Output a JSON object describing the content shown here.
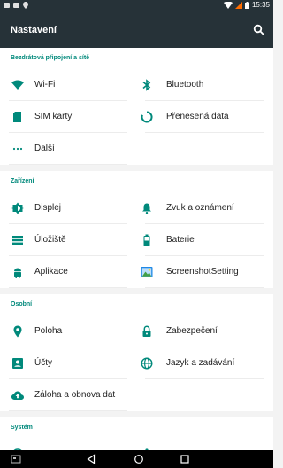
{
  "status_bar": {
    "time": "15:35",
    "left_icons": [
      "image-icon",
      "message-icon",
      "location-pin-icon"
    ],
    "right_icons": [
      "wifi-icon",
      "signal-icon",
      "battery-icon"
    ],
    "signal_accent": "#ff6d00"
  },
  "app_bar": {
    "title": "Nastavení",
    "background": "#263238"
  },
  "accent": "#00897b",
  "sections": {
    "wireless": {
      "header": "Bezdrátová připojení a sítě",
      "items": [
        {
          "label": "Wi-Fi",
          "icon": "wifi-icon"
        },
        {
          "label": "Bluetooth",
          "icon": "bluetooth-icon"
        },
        {
          "label": "SIM karty",
          "icon": "sim-card-icon"
        },
        {
          "label": "Přenesená data",
          "icon": "data-usage-icon"
        },
        {
          "label": "Další",
          "icon": "more-icon"
        }
      ]
    },
    "device": {
      "header": "Zařízení",
      "items": [
        {
          "label": "Displej",
          "icon": "display-brightness-icon"
        },
        {
          "label": "Zvuk a oznámení",
          "icon": "bell-icon"
        },
        {
          "label": "Úložiště",
          "icon": "storage-icon"
        },
        {
          "label": "Baterie",
          "icon": "battery-icon"
        },
        {
          "label": "Aplikace",
          "icon": "android-icon"
        },
        {
          "label": "ScreenshotSetting",
          "icon": "screenshot-app-icon"
        }
      ]
    },
    "personal": {
      "header": "Osobní",
      "items": [
        {
          "label": "Poloha",
          "icon": "location-icon"
        },
        {
          "label": "Zabezpečení",
          "icon": "lock-icon"
        },
        {
          "label": "Účty",
          "icon": "account-icon"
        },
        {
          "label": "Jazyk a zadávání",
          "icon": "globe-icon"
        },
        {
          "label": "Záloha a obnova dat",
          "icon": "cloud-backup-icon"
        }
      ]
    },
    "system": {
      "header": "Systém"
    }
  },
  "nav_bar": {
    "buttons": [
      "screenshot-icon",
      "back-icon",
      "home-icon",
      "recents-icon"
    ]
  }
}
